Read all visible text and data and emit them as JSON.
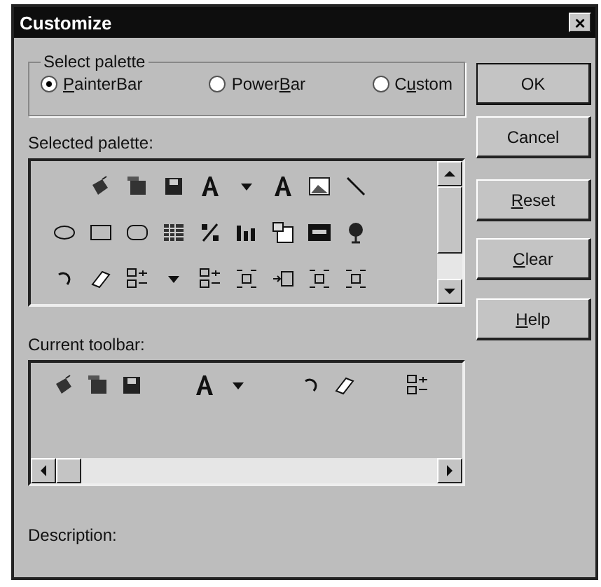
{
  "window": {
    "title": "Customize",
    "close": "×"
  },
  "palette_group": {
    "label": "Select palette",
    "options": [
      {
        "label": "PainterBar",
        "selected": true
      },
      {
        "label": "PowerBar",
        "selected": false
      },
      {
        "label": "Custom",
        "selected": false
      }
    ]
  },
  "selected_palette": {
    "label": "Selected palette:"
  },
  "current_toolbar": {
    "label": "Current toolbar:"
  },
  "description": {
    "label": "Description:"
  },
  "buttons": [
    {
      "label": "OK",
      "default": true
    },
    {
      "label": "Cancel",
      "default": false
    },
    {
      "label": "Reset",
      "default": false
    },
    {
      "label": "Clear",
      "default": false
    },
    {
      "label": "Help",
      "default": false
    }
  ]
}
